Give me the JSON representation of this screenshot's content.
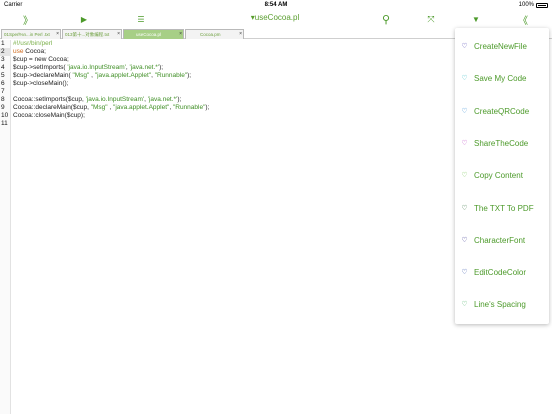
{
  "status": {
    "carrier": "Carrier",
    "time": "8:54 AM",
    "battery": "100%"
  },
  "toolbar": {
    "expand_icon": "》",
    "run_icon": "▶",
    "indent_icon": "☰",
    "title": "▾useCocoa.pl",
    "search_icon": "⚲",
    "fullscreen_icon": "⤧",
    "dropdown_icon": "▼",
    "collapse_icon": "《"
  },
  "tabs": [
    {
      "label": "01Sperl%n...in Perl .txt",
      "close": "×"
    },
    {
      "label": "013第十...对象编程.txt",
      "close": "×"
    },
    {
      "label": "useCocoa.pl",
      "close": "×"
    },
    {
      "label": "Cocoa.pm",
      "close": "×"
    }
  ],
  "editor": {
    "line_numbers": [
      "1",
      "2",
      "3",
      "4",
      "5",
      "6",
      "7",
      "8",
      "9",
      "10",
      "11"
    ],
    "lines": [
      {
        "a": "#!/usr/bin/perl",
        "b": "",
        "c": "",
        "d": "",
        "e": "",
        "f": "",
        "g": ""
      },
      {
        "a": "use",
        "b": " Cocoa;",
        "c": "",
        "d": "",
        "e": "",
        "f": "",
        "g": ""
      },
      {
        "a": "$cup = new Cocoa;",
        "b": "",
        "c": "",
        "d": "",
        "e": "",
        "f": "",
        "g": ""
      },
      {
        "a": "$cup->setImports( ",
        "b": "'java.io.InputStream'",
        "c": ", ",
        "d": "'java.net.*'",
        "e": ");",
        "f": "",
        "g": ""
      },
      {
        "a": "$cup->declareMain( ",
        "b": "\"Msg\"",
        "c": " , ",
        "d": "\"java.applet.Applet\"",
        "e": ", ",
        "f": "\"Runnable\"",
        "g": ");"
      },
      {
        "a": "$cup->closeMain();",
        "b": "",
        "c": "",
        "d": "",
        "e": "",
        "f": "",
        "g": ""
      },
      {
        "a": "",
        "b": "",
        "c": "",
        "d": "",
        "e": "",
        "f": "",
        "g": ""
      },
      {
        "a": "Cocoa::setImports($cup, ",
        "b": "'java.io.InputStream'",
        "c": ", ",
        "d": "'java.net.*'",
        "e": ");",
        "f": "",
        "g": ""
      },
      {
        "a": "Cocoa::declareMain($cup, ",
        "b": "\"Msg\"",
        "c": " , ",
        "d": "\"java.applet.Applet\"",
        "e": ", ",
        "f": "\"Runnable\"",
        "g": ");"
      },
      {
        "a": "Cocoa::closeMain($cup);",
        "b": "",
        "c": "",
        "d": "",
        "e": "",
        "f": "",
        "g": ""
      },
      {
        "a": "",
        "b": "",
        "c": "",
        "d": "",
        "e": "",
        "f": "",
        "g": ""
      }
    ]
  },
  "menu": {
    "items": [
      {
        "label": "CreateNewFile",
        "heart": "♡",
        "heart_color": "#4a3fb0"
      },
      {
        "label": "Save My Code",
        "heart": "♡",
        "heart_color": "#3fc1c9"
      },
      {
        "label": "CreateQRCode",
        "heart": "♡",
        "heart_color": "#3a8fd6"
      },
      {
        "label": "ShareTheCode",
        "heart": "♡",
        "heart_color": "#c04fc8"
      },
      {
        "label": "Copy Content",
        "heart": "♡",
        "heart_color": "#7cc95a"
      },
      {
        "label": "The TXT To PDF",
        "heart": "♡",
        "heart_color": "#2f6e3a"
      },
      {
        "label": "CharacterFont",
        "heart": "♡",
        "heart_color": "#2e2a8a"
      },
      {
        "label": "EditCodeColor",
        "heart": "♡",
        "heart_color": "#2f4fa8"
      },
      {
        "label": "Line's Spacing",
        "heart": "♡",
        "heart_color": "#4fb56a"
      }
    ]
  },
  "colors": {
    "accent": "#4c9a2a",
    "active_tab": "#a7cf86",
    "keyword": "#cf6a1c",
    "string": "#3f8f25"
  }
}
